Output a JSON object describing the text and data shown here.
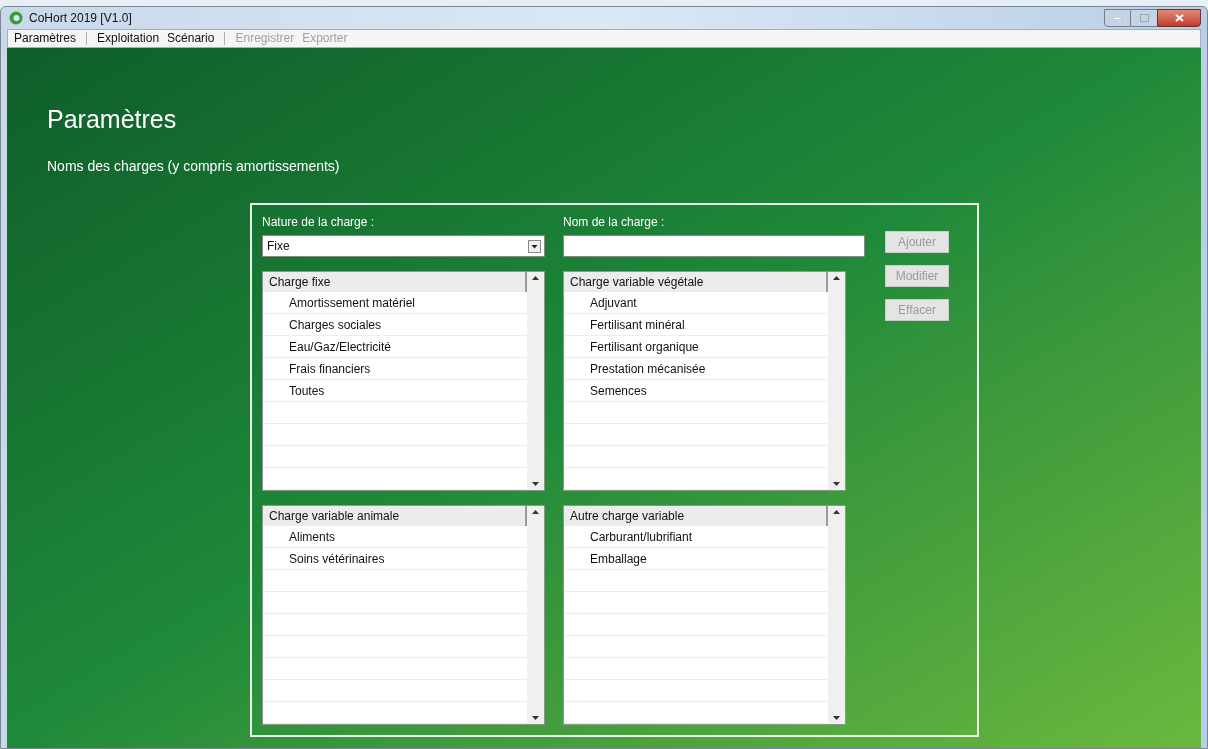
{
  "window": {
    "title": "CoHort 2019 [V1.0]"
  },
  "menu": [
    {
      "label": "Paramètres",
      "disabled": false,
      "separator_after": true
    },
    {
      "label": "Exploitation",
      "disabled": false,
      "separator_after": false
    },
    {
      "label": "Scénario",
      "disabled": false,
      "separator_after": true
    },
    {
      "label": "Enregistrer",
      "disabled": true,
      "separator_after": false
    },
    {
      "label": "Exporter",
      "disabled": true,
      "separator_after": false
    }
  ],
  "page": {
    "title": "Paramètres",
    "subtitle": "Noms des charges (y compris amortissements)"
  },
  "form": {
    "nature_label": "Nature de la charge :",
    "nature_value": "Fixe",
    "name_label": "Nom de la charge :"
  },
  "buttons": [
    {
      "label": "Ajouter",
      "disabled": true
    },
    {
      "label": "Modifier",
      "disabled": true
    },
    {
      "label": "Effacer",
      "disabled": true
    }
  ],
  "lists": [
    {
      "header": "Charge fixe",
      "items": [
        "Amortissement matériel",
        "Charges sociales",
        "Eau/Gaz/Electricité",
        "Frais financiers",
        "Toutes"
      ]
    },
    {
      "header": "Charge variable végétale",
      "items": [
        "Adjuvant",
        "Fertilisant minéral",
        "Fertilisant organique",
        "Prestation mécanisée",
        "Semences"
      ]
    },
    {
      "header": "Charge variable animale",
      "items": [
        "Aliments",
        "Soins vétérinaires"
      ]
    },
    {
      "header": "Autre charge variable",
      "items": [
        "Carburant/lubrifiant",
        "Emballage"
      ]
    }
  ]
}
